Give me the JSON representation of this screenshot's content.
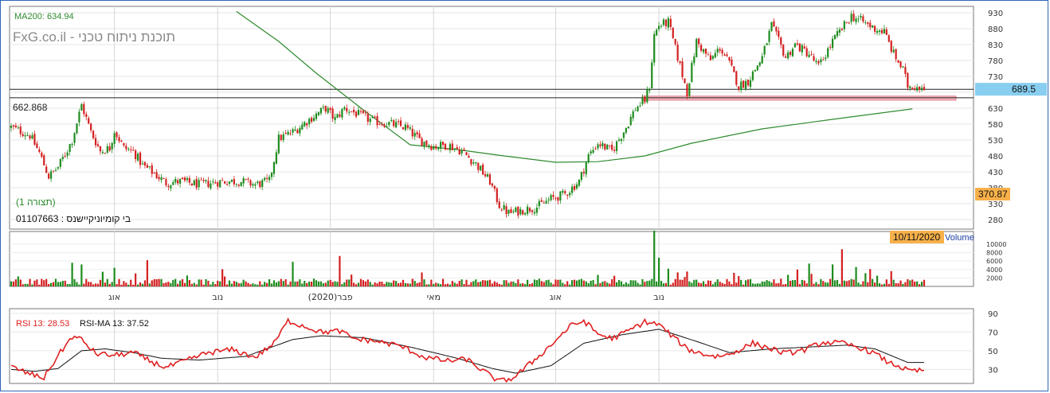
{
  "chart_data": [
    {
      "type": "candlestick",
      "watermark": "FxG.co.il - תוכנת ניתוח טכני",
      "ma_label": "MA200: 634.94",
      "ma_color": "#2e8b2e",
      "symbol_label": "בי קומיוניקיישנס : 01107663",
      "view_label": "(תצורה 1)",
      "hline_value": 662.868,
      "hline_label": "662.868",
      "last_price": 689.5,
      "last_price_label": "689.5",
      "low_label": "370.87",
      "ylim": [
        250,
        950
      ],
      "yticks": [
        280,
        330,
        380,
        430,
        480,
        530,
        580,
        630,
        680,
        730,
        780,
        830,
        880,
        930
      ],
      "support_zone": [
        655,
        668
      ],
      "up_color": "#1e8c1e",
      "down_color": "#d42020",
      "anchors": [
        [
          0,
          570
        ],
        [
          8,
          545
        ],
        [
          12,
          490
        ],
        [
          16,
          415
        ],
        [
          20,
          445
        ],
        [
          24,
          500
        ],
        [
          26,
          530
        ],
        [
          30,
          640
        ],
        [
          34,
          555
        ],
        [
          38,
          495
        ],
        [
          42,
          505
        ],
        [
          44,
          560
        ],
        [
          48,
          505
        ],
        [
          52,
          495
        ],
        [
          56,
          450
        ],
        [
          60,
          430
        ],
        [
          66,
          395
        ],
        [
          72,
          400
        ],
        [
          80,
          390
        ],
        [
          90,
          400
        ],
        [
          98,
          400
        ],
        [
          104,
          390
        ],
        [
          110,
          400
        ],
        [
          114,
          535
        ],
        [
          120,
          555
        ],
        [
          128,
          600
        ],
        [
          134,
          630
        ],
        [
          138,
          595
        ],
        [
          142,
          630
        ],
        [
          148,
          610
        ],
        [
          154,
          590
        ],
        [
          162,
          580
        ],
        [
          168,
          570
        ],
        [
          174,
          530
        ],
        [
          180,
          510
        ],
        [
          186,
          515
        ],
        [
          192,
          495
        ],
        [
          198,
          455
        ],
        [
          204,
          400
        ],
        [
          208,
          325
        ],
        [
          212,
          300
        ],
        [
          218,
          310
        ],
        [
          224,
          320
        ],
        [
          230,
          345
        ],
        [
          236,
          360
        ],
        [
          242,
          400
        ],
        [
          246,
          480
        ],
        [
          250,
          520
        ],
        [
          256,
          495
        ],
        [
          262,
          570
        ],
        [
          266,
          630
        ],
        [
          270,
          655
        ],
        [
          272,
          700
        ],
        [
          274,
          860
        ],
        [
          276,
          890
        ],
        [
          280,
          900
        ],
        [
          284,
          790
        ],
        [
          288,
          680
        ],
        [
          292,
          840
        ],
        [
          298,
          780
        ],
        [
          302,
          820
        ],
        [
          306,
          770
        ],
        [
          310,
          700
        ],
        [
          314,
          715
        ],
        [
          320,
          790
        ],
        [
          324,
          890
        ],
        [
          330,
          790
        ],
        [
          334,
          830
        ],
        [
          340,
          800
        ],
        [
          344,
          760
        ],
        [
          350,
          840
        ],
        [
          354,
          880
        ],
        [
          358,
          920
        ],
        [
          362,
          905
        ],
        [
          368,
          880
        ],
        [
          372,
          870
        ],
        [
          376,
          800
        ],
        [
          380,
          750
        ],
        [
          382,
          700
        ]
      ],
      "ma_points": [
        [
          96,
          934
        ],
        [
          114,
          840
        ],
        [
          130,
          740
        ],
        [
          150,
          625
        ],
        [
          170,
          515
        ],
        [
          190,
          500
        ],
        [
          210,
          480
        ],
        [
          232,
          460
        ],
        [
          250,
          462
        ],
        [
          270,
          480
        ],
        [
          290,
          520
        ],
        [
          320,
          565
        ],
        [
          350,
          595
        ],
        [
          384,
          628
        ]
      ]
    },
    {
      "type": "bar",
      "label": "Volume",
      "date_label": "10/11/2020",
      "ylim": [
        0,
        13000
      ],
      "yticks": [
        2000,
        4000,
        6000,
        8000,
        10000
      ],
      "spikes": [
        [
          26,
          5600
        ],
        [
          30,
          5200
        ],
        [
          44,
          4400
        ],
        [
          58,
          6200
        ],
        [
          120,
          5800
        ],
        [
          140,
          7200
        ],
        [
          274,
          13200
        ],
        [
          276,
          6800
        ],
        [
          280,
          4200
        ],
        [
          340,
          5400
        ],
        [
          350,
          5200
        ],
        [
          354,
          8800
        ],
        [
          360,
          4600
        ],
        [
          366,
          4100
        ]
      ]
    },
    {
      "type": "line",
      "label": "RSI 13: 28.53",
      "ma_label": "RSI-MA 13: 37.52",
      "rsi_color": "#e02020",
      "ylim": [
        15,
        95
      ],
      "yticks": [
        30,
        50,
        70,
        90
      ],
      "anchors": [
        [
          0,
          33
        ],
        [
          8,
          25
        ],
        [
          14,
          21
        ],
        [
          20,
          45
        ],
        [
          26,
          65
        ],
        [
          30,
          62
        ],
        [
          36,
          47
        ],
        [
          44,
          45
        ],
        [
          52,
          48
        ],
        [
          60,
          38
        ],
        [
          66,
          32
        ],
        [
          74,
          39
        ],
        [
          84,
          48
        ],
        [
          94,
          51
        ],
        [
          104,
          43
        ],
        [
          112,
          58
        ],
        [
          118,
          82
        ],
        [
          124,
          77
        ],
        [
          132,
          70
        ],
        [
          140,
          71
        ],
        [
          146,
          63
        ],
        [
          156,
          60
        ],
        [
          166,
          55
        ],
        [
          176,
          43
        ],
        [
          186,
          39
        ],
        [
          194,
          41
        ],
        [
          202,
          27
        ],
        [
          208,
          17
        ],
        [
          214,
          21
        ],
        [
          222,
          38
        ],
        [
          230,
          56
        ],
        [
          238,
          76
        ],
        [
          244,
          82
        ],
        [
          250,
          68
        ],
        [
          256,
          63
        ],
        [
          262,
          70
        ],
        [
          270,
          81
        ],
        [
          276,
          78
        ],
        [
          282,
          65
        ],
        [
          288,
          52
        ],
        [
          294,
          47
        ],
        [
          300,
          44
        ],
        [
          306,
          46
        ],
        [
          316,
          58
        ],
        [
          324,
          52
        ],
        [
          330,
          47
        ],
        [
          338,
          51
        ],
        [
          346,
          59
        ],
        [
          354,
          58
        ],
        [
          362,
          53
        ],
        [
          368,
          47
        ],
        [
          374,
          37
        ],
        [
          378,
          34
        ],
        [
          382,
          28.5
        ]
      ],
      "ma_anchors": [
        [
          0,
          30
        ],
        [
          10,
          28
        ],
        [
          20,
          31
        ],
        [
          30,
          50
        ],
        [
          40,
          52
        ],
        [
          52,
          48
        ],
        [
          64,
          42
        ],
        [
          80,
          40
        ],
        [
          100,
          44
        ],
        [
          120,
          62
        ],
        [
          132,
          66
        ],
        [
          150,
          64
        ],
        [
          170,
          54
        ],
        [
          190,
          42
        ],
        [
          205,
          31
        ],
        [
          215,
          26
        ],
        [
          230,
          34
        ],
        [
          244,
          58
        ],
        [
          260,
          67
        ],
        [
          276,
          73
        ],
        [
          292,
          60
        ],
        [
          306,
          48
        ],
        [
          324,
          52
        ],
        [
          340,
          54
        ],
        [
          356,
          56
        ],
        [
          368,
          52
        ],
        [
          382,
          37.5
        ]
      ]
    }
  ],
  "x_axis": {
    "labels": [
      "אוג",
      "נוב",
      "פבר(2020)",
      "מאי",
      "אוג",
      "נוב"
    ],
    "positions": [
      44,
      88,
      136,
      180,
      232,
      276
    ]
  },
  "n_bars": 390
}
